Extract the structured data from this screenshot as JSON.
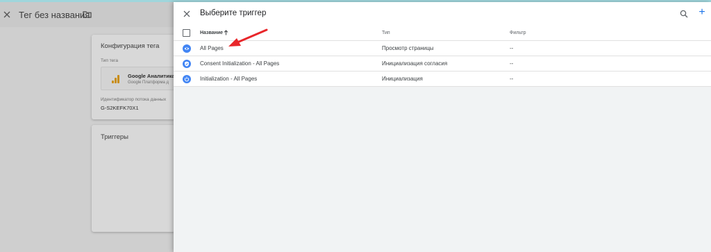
{
  "background_editor": {
    "title": "Тег без названия",
    "config_card": {
      "title": "Конфигурация тега",
      "tag_type_label": "Тип тега",
      "tag_name": "Google Аналитика",
      "tag_sub": "Google Платформа д",
      "stream_label": "Идентификатор потока данных",
      "stream_value": "G-S2KEFK70X1"
    },
    "triggers_card": {
      "title": "Триггеры"
    }
  },
  "panel": {
    "title": "Выберите триггер",
    "icons": {
      "close": "close-icon",
      "search": "search-icon",
      "add": "plus-icon"
    },
    "add_symbol": "+",
    "columns": {
      "name": "Название",
      "type": "Тип",
      "filter": "Фильтр"
    },
    "rows": [
      {
        "name": "All Pages",
        "type": "Просмотр страницы",
        "filter": "--",
        "icon": "eye-icon"
      },
      {
        "name": "Consent Initialization - All Pages",
        "type": "Инициализация согласия",
        "filter": "--",
        "icon": "shield-icon"
      },
      {
        "name": "Initialization - All Pages",
        "type": "Инициализация",
        "filter": "--",
        "icon": "power-icon"
      }
    ]
  },
  "colors": {
    "accent": "#1a73e8",
    "trigger_icon": "#4285f4",
    "annotation_arrow": "#e8262a"
  }
}
